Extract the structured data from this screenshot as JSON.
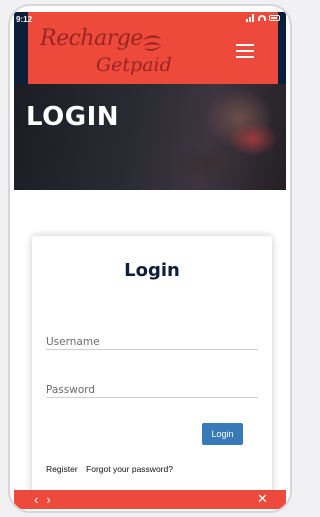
{
  "status_bar": {
    "time": "9:12"
  },
  "logo": {
    "word1": "Recharge",
    "word2": "Getpaid"
  },
  "hero": {
    "title": "LOGIN"
  },
  "login_card": {
    "title": "Login",
    "username_placeholder": "Username",
    "password_placeholder": "Password",
    "login_label": "Login",
    "register_label": "Register",
    "forgot_label": "Forgot your password?"
  },
  "bottom_bar": {
    "back": "‹",
    "forward": "›",
    "close": "✕"
  },
  "colors": {
    "brand_red": "#ee4a3b",
    "navy": "#0c1f3a",
    "button_blue": "#3779b9"
  }
}
